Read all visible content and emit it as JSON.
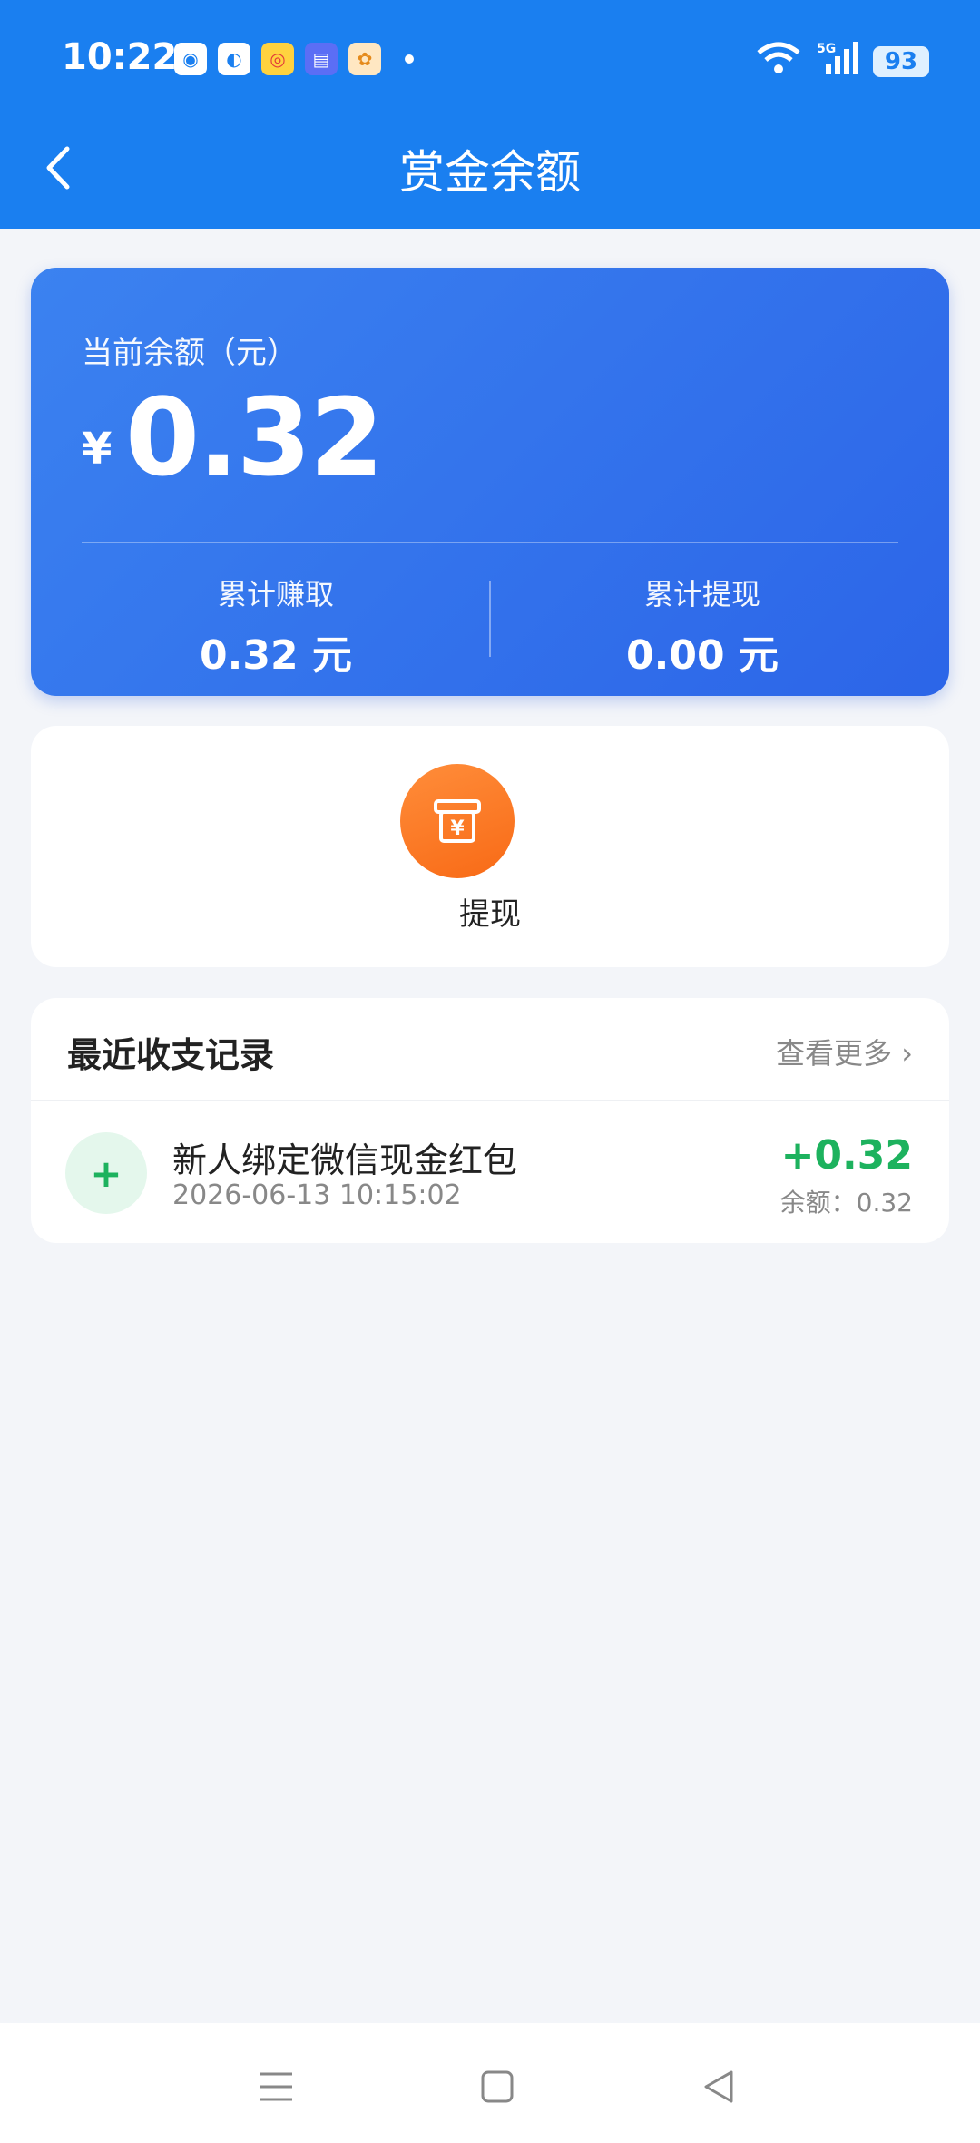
{
  "status_bar": {
    "time": "10:22",
    "notification_icons": [
      "app-icon-1",
      "app-icon-2",
      "weibo-icon",
      "message-icon",
      "pet-icon"
    ],
    "network": "5G",
    "battery": "93"
  },
  "header": {
    "title": "赏金余额"
  },
  "balance": {
    "label": "当前余额（元）",
    "currency": "¥",
    "value": "0.32",
    "earned_label": "累计赚取",
    "earned_value": "0.32 元",
    "withdrawn_label": "累计提现",
    "withdrawn_value": "0.00 元"
  },
  "actions": {
    "withdraw_label": "提现"
  },
  "records": {
    "title": "最近收支记录",
    "more": "查看更多 ›",
    "items": [
      {
        "name": "新人绑定微信现金红包",
        "time": "2026-06-13 10:15:02",
        "amount": "+0.32",
        "balance": "余额：0.32"
      }
    ]
  },
  "colors": {
    "primary": "#1a7ff0",
    "card": "#2c65e8",
    "accent": "#f86a16",
    "positive": "#1db25e"
  }
}
